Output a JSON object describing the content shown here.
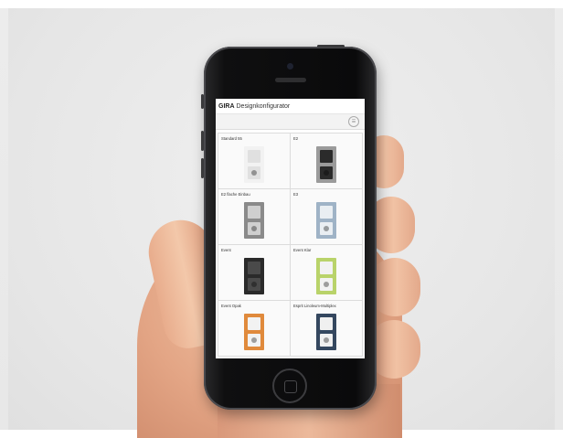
{
  "app": {
    "brand": "GIRA",
    "title": "Designkonfigurator"
  },
  "toolbar": {
    "menu_icon": "menu-icon"
  },
  "products": [
    {
      "label": "Standard 55",
      "frame": "#f2f2f2",
      "insert": "#e0e0e0"
    },
    {
      "label": "E2",
      "frame": "#9b9b9b",
      "insert": "#2b2b2b"
    },
    {
      "label": "E2 flache Einbau",
      "frame": "#8a8a8a",
      "insert": "#cfcfcf"
    },
    {
      "label": "E3",
      "frame": "#9fb3c6",
      "insert": "#e9eef2"
    },
    {
      "label": "Event",
      "frame": "#2a2a2a",
      "insert": "#4a4a4a"
    },
    {
      "label": "Event Klar",
      "frame": "#b9d36a",
      "insert": "#f2f2f2"
    },
    {
      "label": "Event Opak",
      "frame": "#e08a3c",
      "insert": "#f2f2f2"
    },
    {
      "label": "Esprit Linoleum-Multiplex",
      "frame": "#34475f",
      "insert": "#f0f0f0"
    }
  ]
}
